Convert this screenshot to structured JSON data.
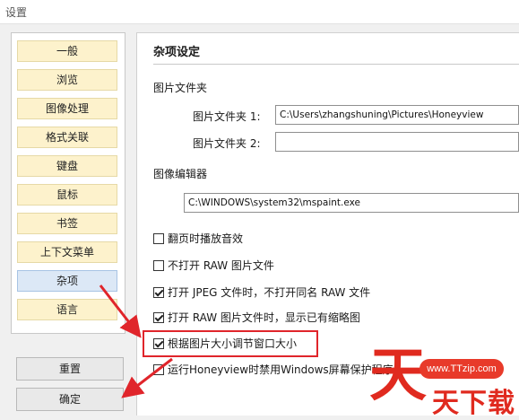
{
  "window": {
    "title": "设置"
  },
  "sidebar": {
    "items": [
      {
        "label": "一般"
      },
      {
        "label": "浏览"
      },
      {
        "label": "图像处理"
      },
      {
        "label": "格式关联"
      },
      {
        "label": "键盘"
      },
      {
        "label": "鼠标"
      },
      {
        "label": "书签"
      },
      {
        "label": "上下文菜单"
      },
      {
        "label": "杂项",
        "active": true
      },
      {
        "label": "语言"
      }
    ],
    "reset_label": "重置",
    "ok_label": "确定"
  },
  "main": {
    "title": "杂项设定",
    "picture_folder": {
      "section_label": "图片文件夹",
      "folder1_label": "图片文件夹 1:",
      "folder1_value": "C:\\Users\\zhangshuning\\Pictures\\Honeyview",
      "folder2_label": "图片文件夹 2:",
      "folder2_value": ""
    },
    "image_editor": {
      "section_label": "图像编辑器",
      "path": "C:\\WINDOWS\\system32\\mspaint.exe"
    },
    "options": [
      {
        "label": "翻页时播放音效",
        "checked": false
      },
      {
        "label": "不打开 RAW 图片文件",
        "checked": false
      },
      {
        "label": "打开 JPEG 文件时，不打开同名 RAW 文件",
        "checked": true
      },
      {
        "label": "打开 RAW 图片文件时，显示已有缩略图",
        "checked": true
      },
      {
        "label": "根据图片大小调节窗口大小",
        "checked": true
      },
      {
        "label": "运行Honeyview时禁用Windows屏幕保护程序",
        "checked": false
      }
    ]
  },
  "annotation": {
    "highlight_color": "#e0252b",
    "arrow_color": "#e0252b"
  },
  "watermark": {
    "site": "www.TTzip.com",
    "big_char": "天",
    "text": "天下载"
  }
}
